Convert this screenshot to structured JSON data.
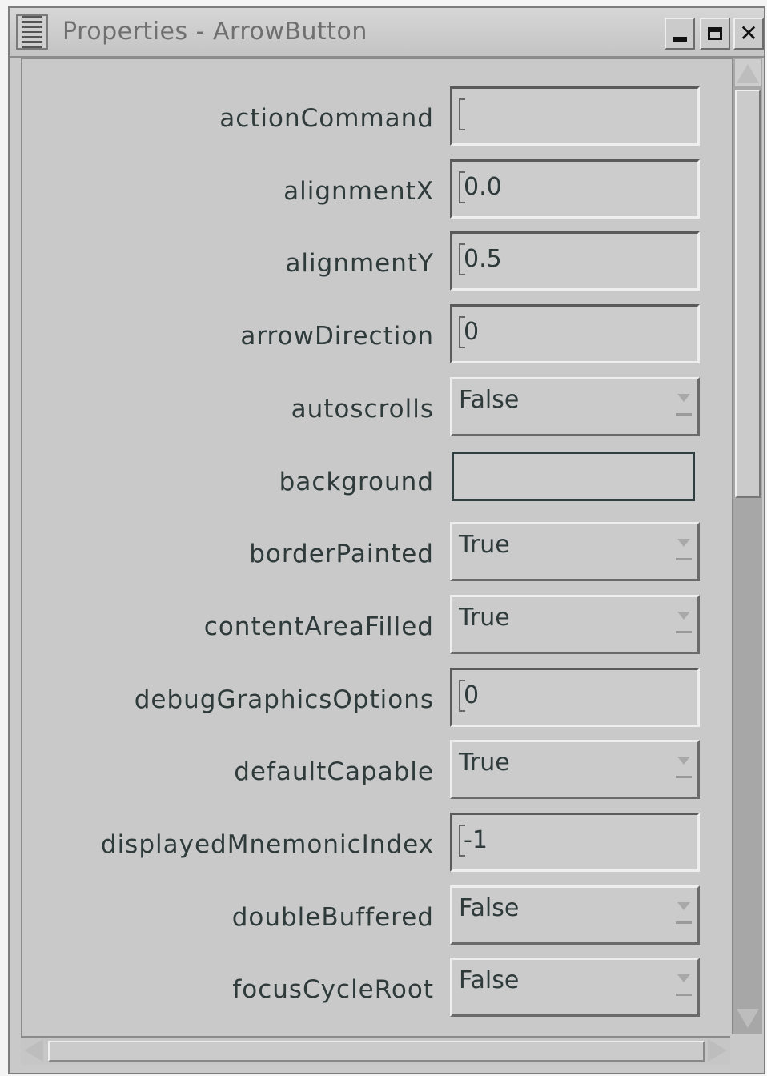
{
  "window": {
    "title": "Properties - ArrowButton"
  },
  "properties": [
    {
      "name": "actionCommand",
      "type": "text",
      "value": ""
    },
    {
      "name": "alignmentX",
      "type": "text",
      "value": "0.0"
    },
    {
      "name": "alignmentY",
      "type": "text",
      "value": "0.5"
    },
    {
      "name": "arrowDirection",
      "type": "text",
      "value": "0"
    },
    {
      "name": "autoscrolls",
      "type": "combo",
      "value": "False"
    },
    {
      "name": "background",
      "type": "color",
      "value": "#cccccc"
    },
    {
      "name": "borderPainted",
      "type": "combo",
      "value": "True"
    },
    {
      "name": "contentAreaFilled",
      "type": "combo",
      "value": "True"
    },
    {
      "name": "debugGraphicsOptions",
      "type": "text",
      "value": "0"
    },
    {
      "name": "defaultCapable",
      "type": "combo",
      "value": "True"
    },
    {
      "name": "displayedMnemonicIndex",
      "type": "text",
      "value": "-1"
    },
    {
      "name": "doubleBuffered",
      "type": "combo",
      "value": "False"
    },
    {
      "name": "focusCycleRoot",
      "type": "combo",
      "value": "False"
    }
  ],
  "icons": {
    "window_menu": "window-menu-icon",
    "minimize": "minimize-icon",
    "maximize": "maximize-icon",
    "close": "close-icon",
    "combo_arrow": "chevron-down-icon"
  }
}
